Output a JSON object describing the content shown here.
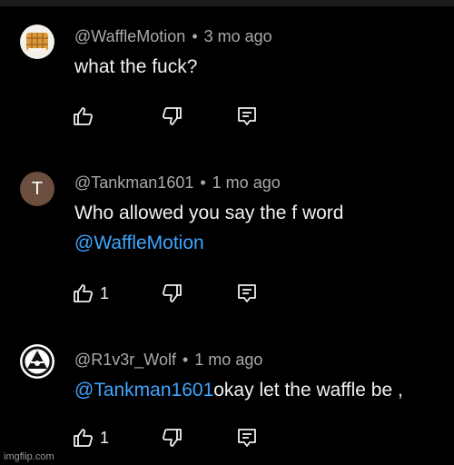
{
  "comments": [
    {
      "author": "@WaffleMotion",
      "separator": "•",
      "time": "3 mo ago",
      "avatar_icon": "waffle-avatar",
      "text": "what the fuck?",
      "likes": ""
    },
    {
      "author": "@Tankman1601",
      "separator": "•",
      "time": "1 mo ago",
      "avatar_icon": "letter-avatar",
      "avatar_letter": "T",
      "text": "Who allowed you say the f word",
      "mention": "@WaffleMotion",
      "likes": "1"
    },
    {
      "author": "@R1v3r_Wolf",
      "separator": "•",
      "time": "1 mo ago",
      "avatar_icon": "wolf-avatar",
      "mention": "@Tankman1601",
      "text": "okay let the waffle be ,",
      "likes": "1"
    }
  ],
  "watermark": "imgflip.com",
  "colors": {
    "background": "#000000",
    "text": "#f1f1f1",
    "meta": "#aaaaaa",
    "mention": "#3ea6ff"
  }
}
